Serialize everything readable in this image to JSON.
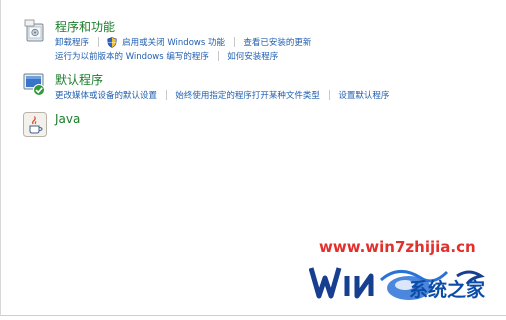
{
  "programs": {
    "title": "程序和功能",
    "icon": "programs-features-icon",
    "links_row1": [
      "卸载程序",
      "启用或关闭 Windows 功能",
      "查看已安装的更新"
    ],
    "links_row2": [
      "运行为以前版本的 Windows 编写的程序",
      "如何安装程序"
    ]
  },
  "defaults": {
    "title": "默认程序",
    "icon": "default-programs-icon",
    "links_row1": [
      "更改媒体或设备的默认设置",
      "始终使用指定的程序打开某种文件类型",
      "设置默认程序"
    ]
  },
  "java": {
    "title": "Java",
    "icon": "java-icon"
  },
  "watermark": {
    "url": "www.win7zhijia.cn",
    "brand": "系统之家",
    "logo_text": "Win7"
  },
  "colors": {
    "title_green": "#1a7d2a",
    "link_blue": "#1f5fb0",
    "watermark_red": "#e2302d",
    "watermark_blue": "#0a4ca8"
  }
}
